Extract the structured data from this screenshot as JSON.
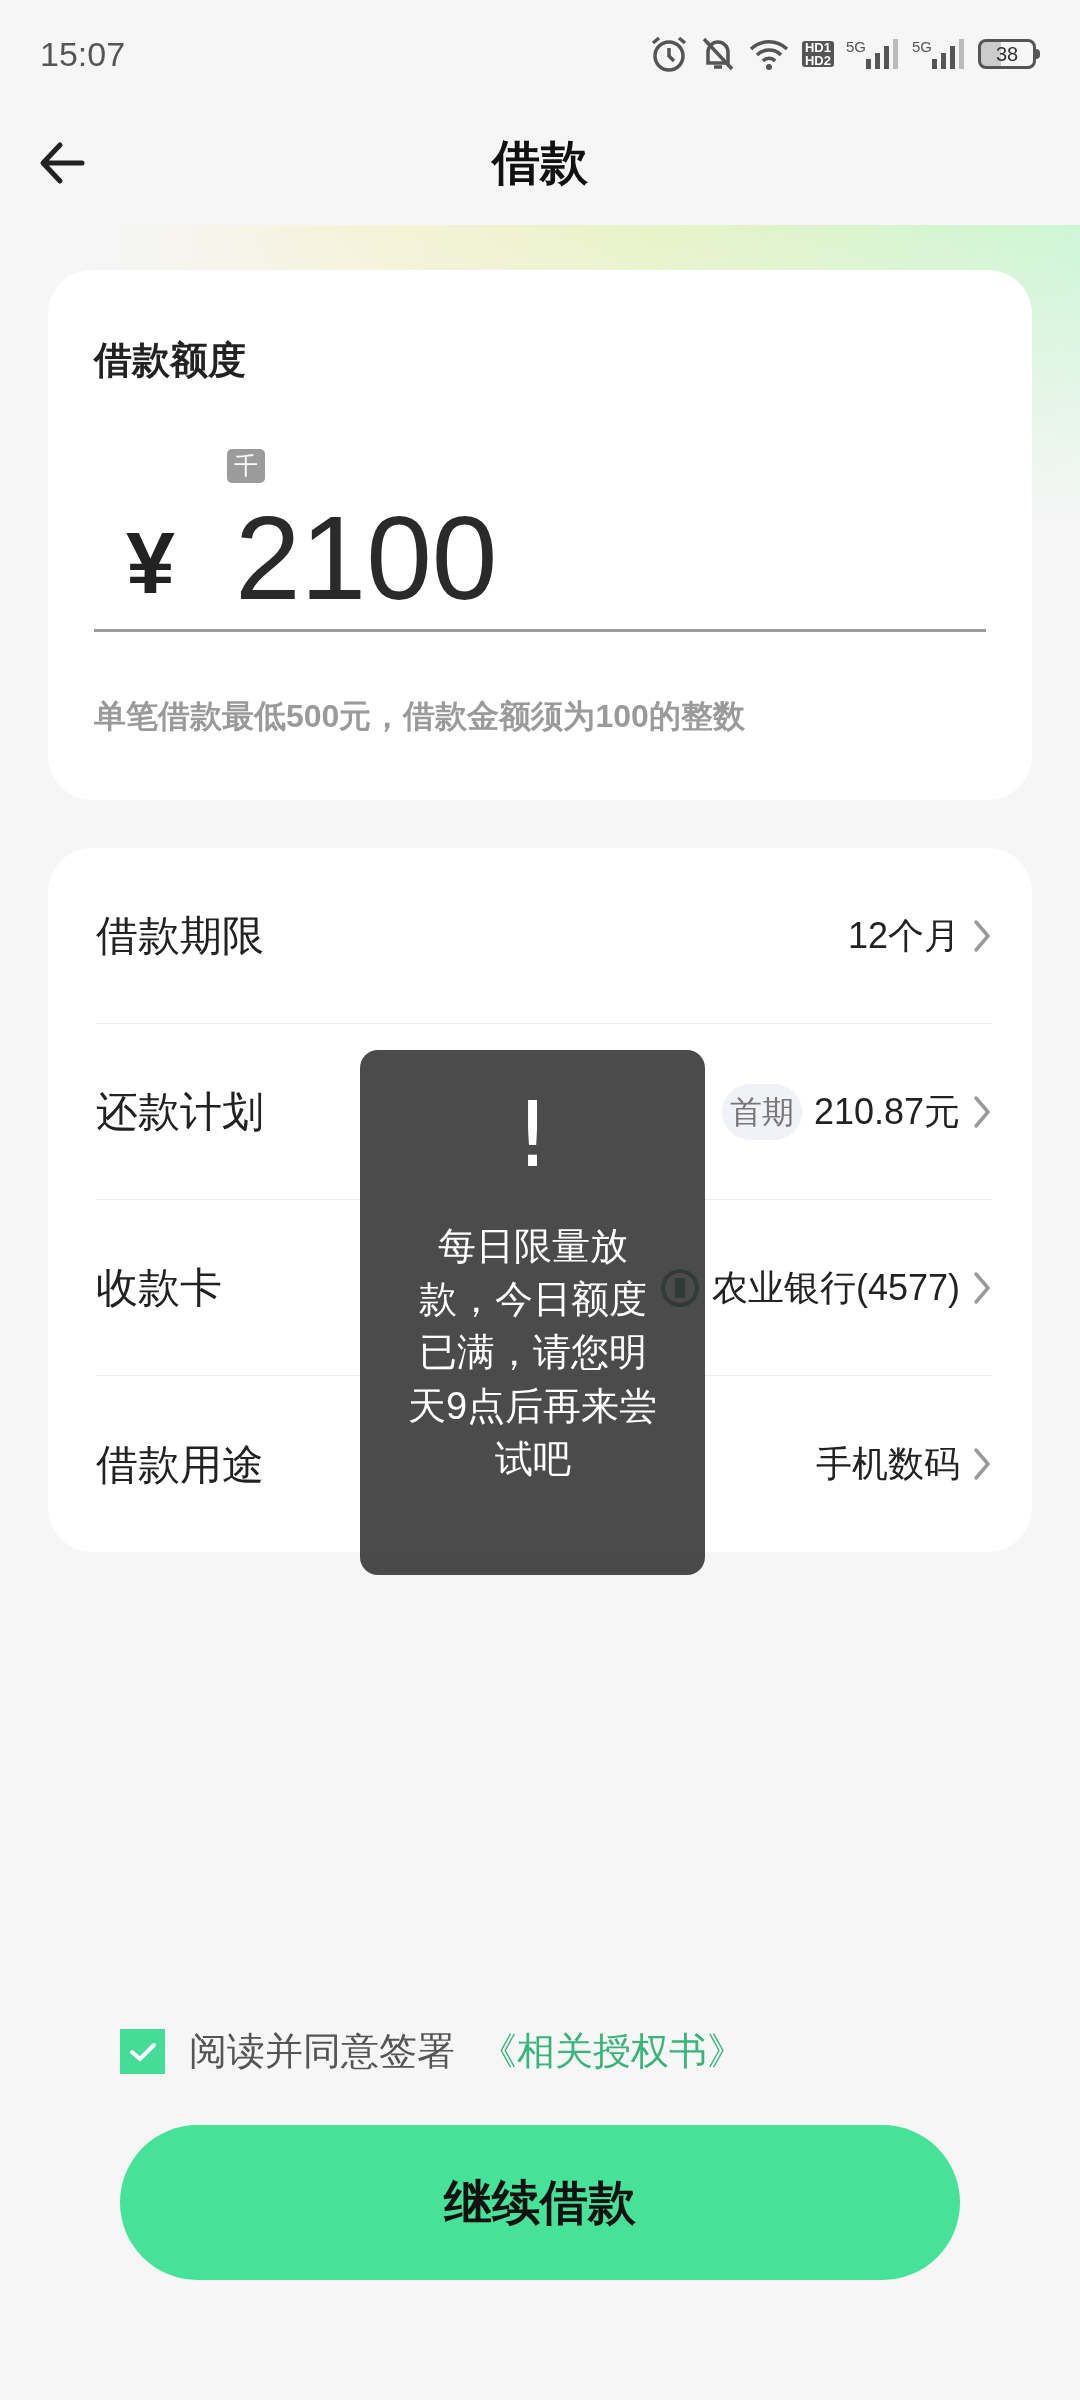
{
  "status_bar": {
    "time": "15:07",
    "hd_top": "HD1",
    "hd_bottom": "HD2",
    "sim_1": "5G",
    "sim_2": "5G",
    "battery": "38"
  },
  "header": {
    "title": "借款"
  },
  "amount_card": {
    "title": "借款额度",
    "currency": "¥",
    "amount": "2100",
    "unit_hint": "千",
    "note": "单笔借款最低500元，借款金额须为100的整数"
  },
  "options": [
    {
      "kind": "plain",
      "label": "借款期限",
      "value": "12个月"
    },
    {
      "kind": "badge",
      "label": "还款计划",
      "badge": "首期",
      "value": "210.87元"
    },
    {
      "kind": "bank",
      "label": "收款卡",
      "value": "农业银行(4577)"
    },
    {
      "kind": "plain",
      "label": "借款用途",
      "value": "手机数码"
    }
  ],
  "toast": {
    "icon": "!",
    "message": "每日限量放款，今日额度已满，请您明天9点后再来尝试吧"
  },
  "agreement": {
    "checked": true,
    "text": "阅读并同意签署",
    "link": "《相关授权书》"
  },
  "submit": {
    "label": "继续借款"
  }
}
